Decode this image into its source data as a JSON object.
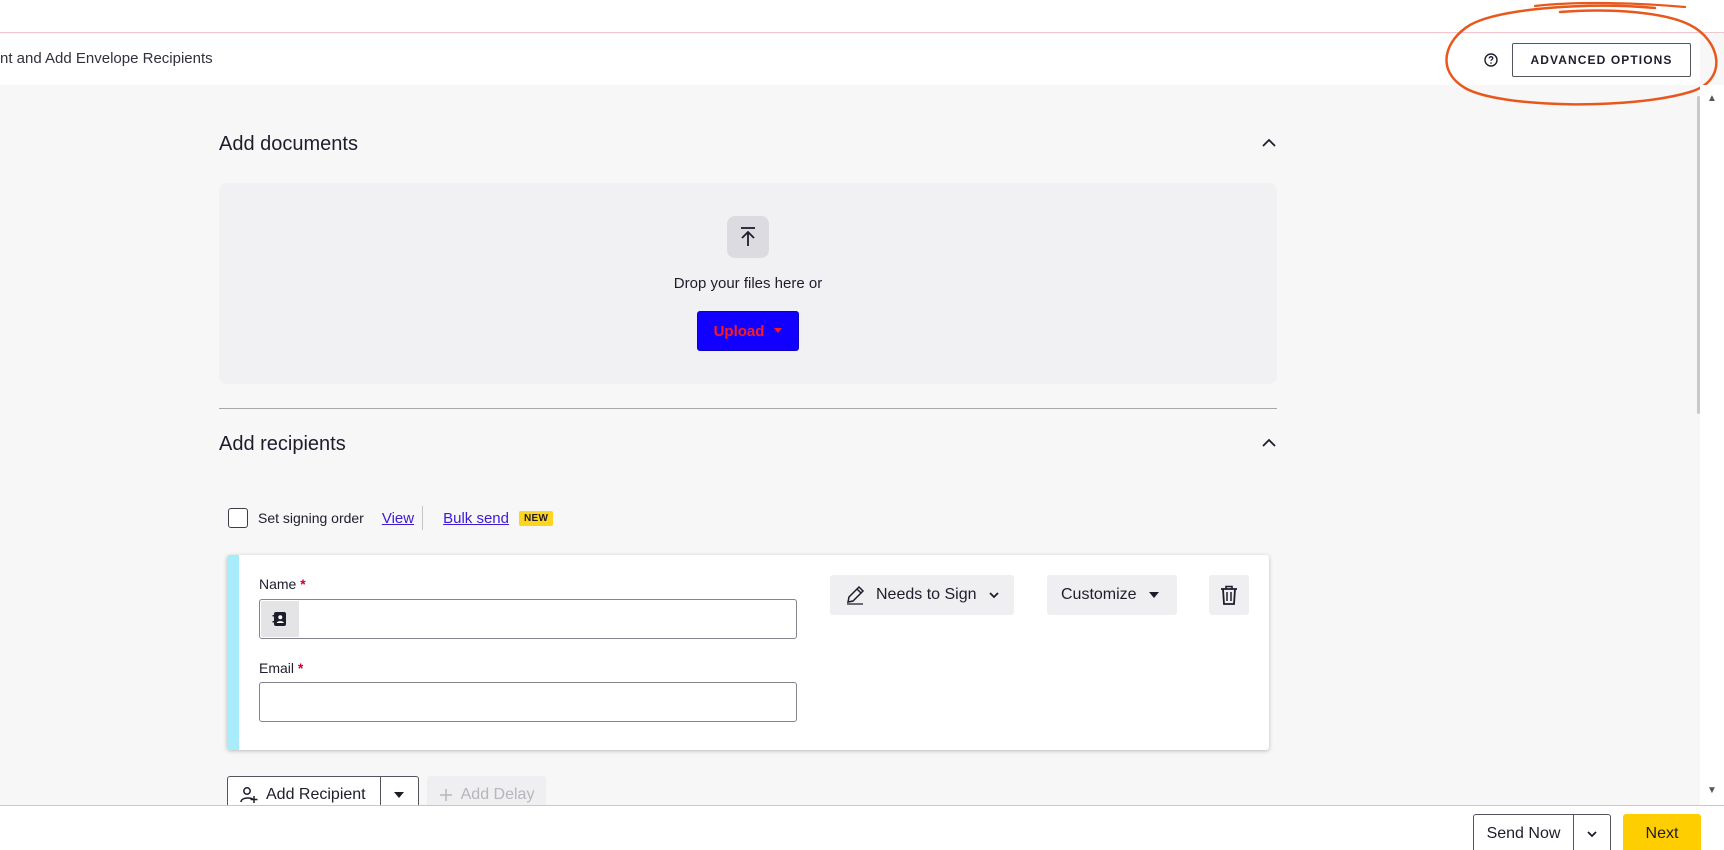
{
  "header": {
    "title": "nt and Add Envelope Recipients",
    "advanced_options_label": "ADVANCED OPTIONS",
    "help_icon": "question-circle-icon"
  },
  "documents": {
    "title": "Add documents",
    "drop_text": "Drop your files here or",
    "upload_label": "Upload",
    "upload_icon": "upload-arrow-icon",
    "collapse_icon": "chevron-up-icon"
  },
  "recipients": {
    "title": "Add recipients",
    "signing_order_label": "Set signing order",
    "view_link": "View",
    "bulk_send_link": "Bulk send",
    "new_badge": "NEW",
    "card": {
      "name_label": "Name",
      "email_label": "Email",
      "required_mark": "*",
      "name_value": "",
      "email_value": "",
      "role_label": "Needs to Sign",
      "customize_label": "Customize"
    },
    "add_recipient_label": "Add Recipient",
    "add_delay_label": "Add Delay"
  },
  "footer": {
    "send_now_label": "Send Now",
    "next_label": "Next"
  },
  "colors": {
    "accent_blue": "#1100ff",
    "upload_text": "#ff1a1a",
    "next_yellow": "#ffce00",
    "link_purple": "#3d1bd6",
    "card_stripe": "#a8ecfb",
    "annotation": "#e8581c"
  }
}
